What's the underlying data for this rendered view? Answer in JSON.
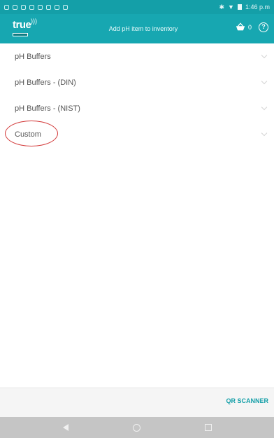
{
  "statusbar": {
    "time": "1:46 p.m"
  },
  "toolbar": {
    "logo_text": "true",
    "title": "Add pH item to inventory",
    "cart_count": "0",
    "help_label": "?"
  },
  "list": {
    "items": [
      {
        "label": "pH Buffers"
      },
      {
        "label": "pH Buffers - (DIN)"
      },
      {
        "label": "pH Buffers - (NIST)"
      },
      {
        "label": "Custom"
      }
    ]
  },
  "bottombar": {
    "qr_label": "QR SCANNER"
  },
  "colors": {
    "accent": "#17a7b1",
    "annotation": "#d33a3a"
  },
  "icons": {
    "status": [
      "notification-icon",
      "wifi-icon",
      "battery-icon"
    ],
    "toolbar": [
      "cart-icon",
      "help-icon"
    ],
    "nav": [
      "back-icon",
      "home-icon",
      "recents-icon"
    ]
  }
}
